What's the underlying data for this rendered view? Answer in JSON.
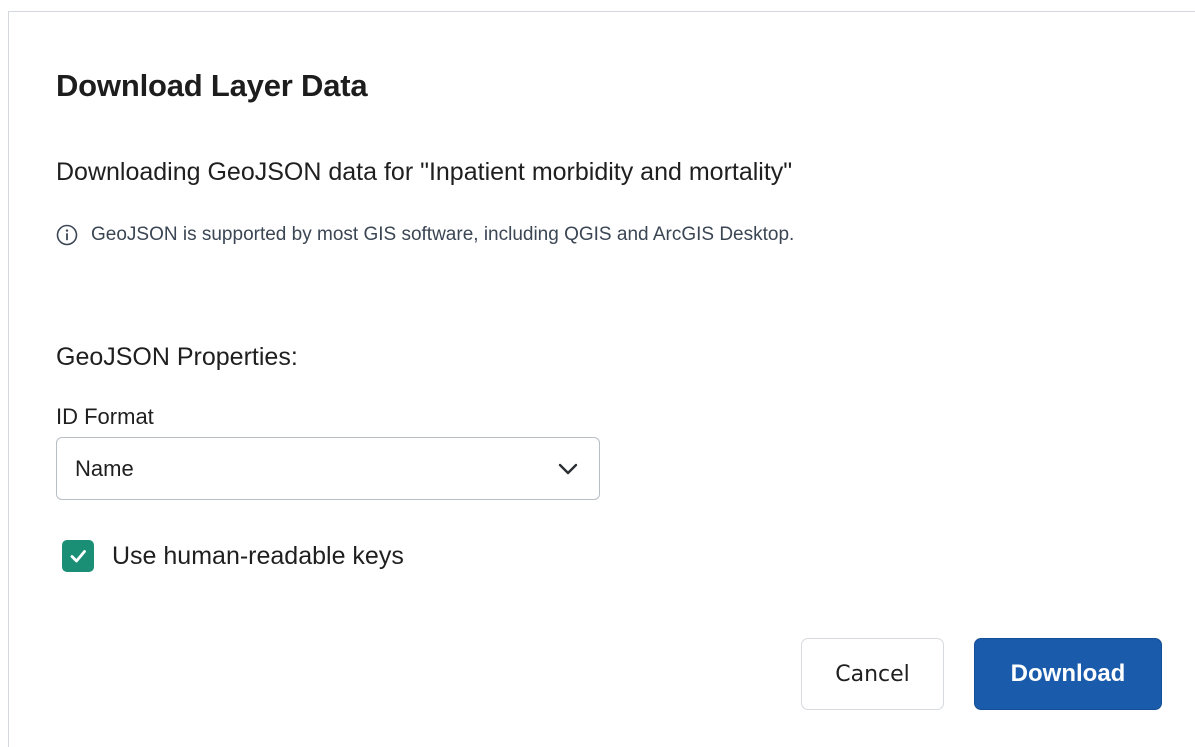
{
  "dialog": {
    "title": "Download Layer Data",
    "subtitle": "Downloading GeoJSON data for \"Inpatient morbidity and mortality\"",
    "info": {
      "icon": "info-icon",
      "text": "GeoJSON is supported by most GIS software, including QGIS and ArcGIS Desktop."
    },
    "properties_heading": "GeoJSON Properties:",
    "id_format": {
      "label": "ID Format",
      "selected": "Name"
    },
    "human_readable": {
      "label": "Use human-readable keys",
      "checked": true
    },
    "buttons": {
      "cancel": "Cancel",
      "download": "Download"
    }
  },
  "colors": {
    "primary": "#1a5cab",
    "checkbox": "#1a8f76",
    "info_text": "#3b4654"
  }
}
